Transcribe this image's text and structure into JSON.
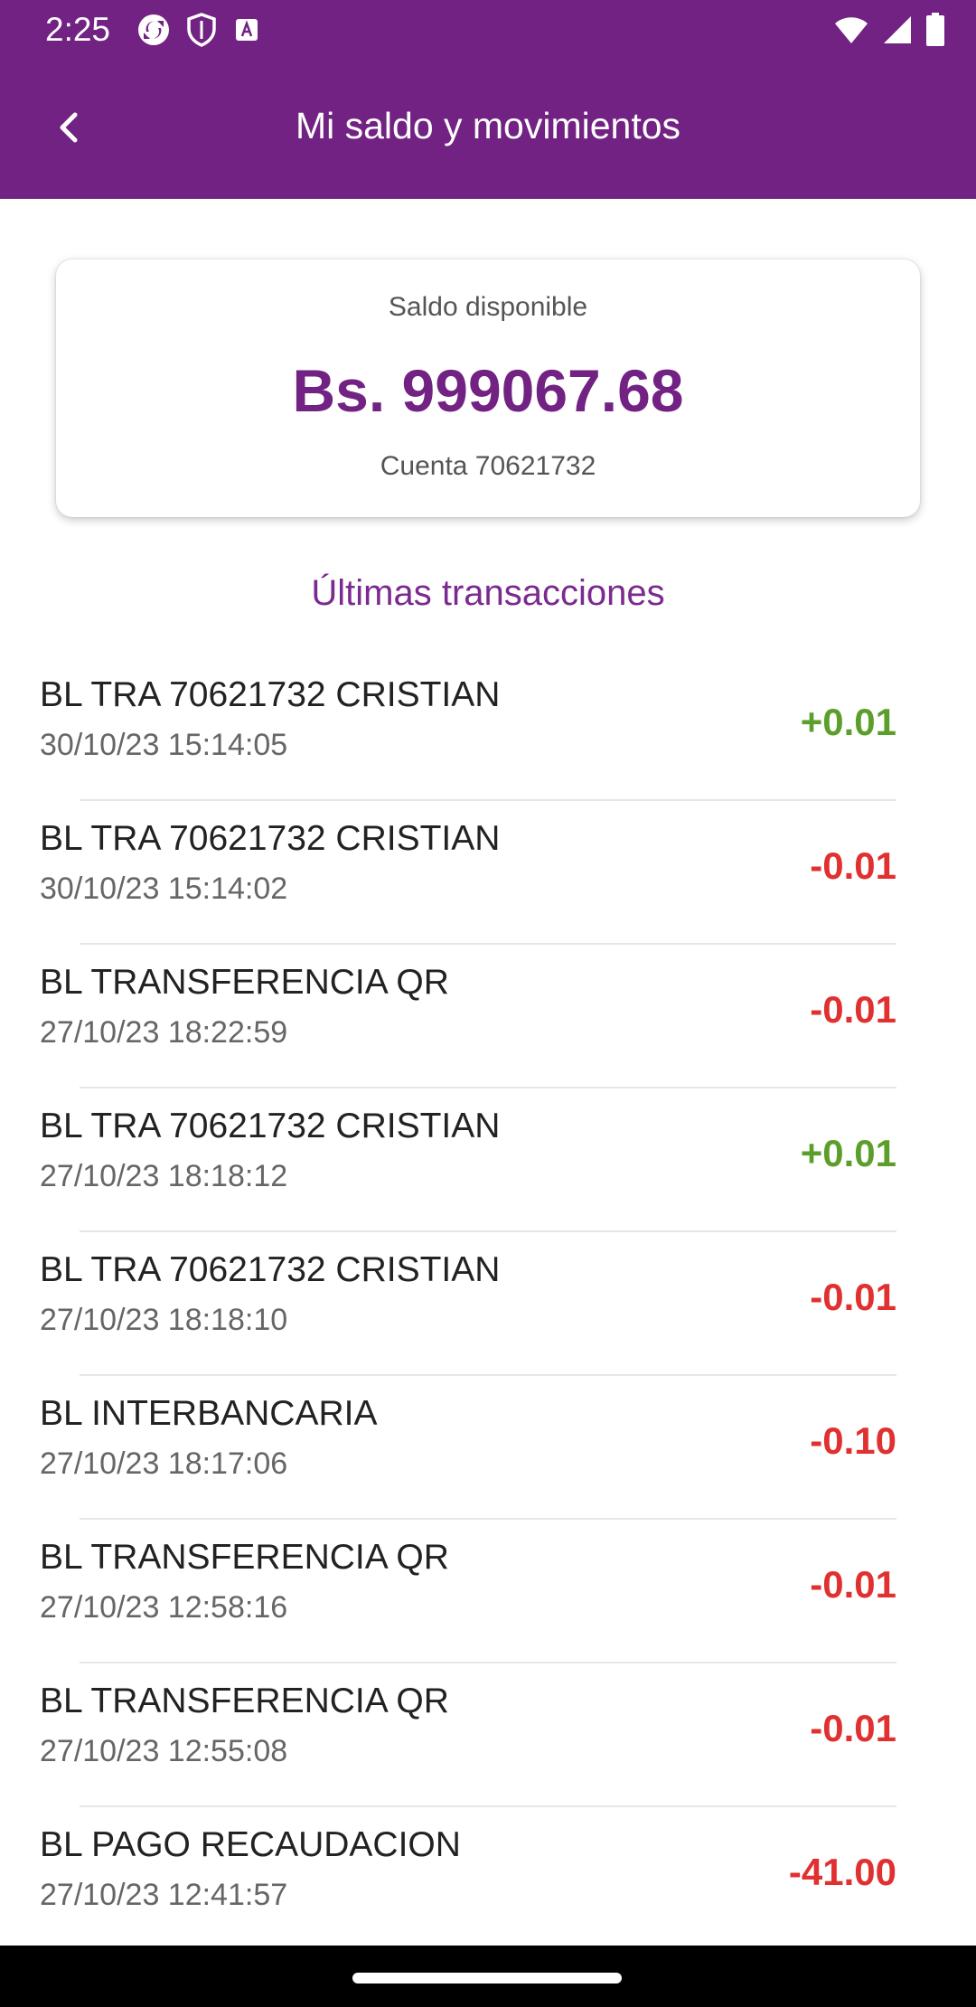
{
  "status_bar": {
    "time": "2:25",
    "left_icons": [
      "sync-app-icon",
      "shield-icon",
      "font-a-icon"
    ],
    "right_icons": [
      "wifi-icon",
      "signal-icon",
      "battery-icon"
    ]
  },
  "app_bar": {
    "title": "Mi saldo y movimientos",
    "back_icon": "chevron-left-icon",
    "background": "#722282"
  },
  "balance": {
    "label": "Saldo disponible",
    "amount": "Bs. 999067.68",
    "account": "Cuenta 70621732"
  },
  "transactions_section": {
    "title": "Últimas transacciones"
  },
  "transactions": [
    {
      "description": "BL TRA 70621732 CRISTIAN",
      "date": "30/10/23 15:14:05",
      "amount": "+0.01",
      "type": "credit"
    },
    {
      "description": "BL TRA 70621732 CRISTIAN",
      "date": "30/10/23 15:14:02",
      "amount": "-0.01",
      "type": "debit"
    },
    {
      "description": "BL TRANSFERENCIA QR",
      "date": "27/10/23 18:22:59",
      "amount": "-0.01",
      "type": "debit"
    },
    {
      "description": "BL TRA 70621732 CRISTIAN",
      "date": "27/10/23 18:18:12",
      "amount": "+0.01",
      "type": "credit"
    },
    {
      "description": "BL TRA 70621732 CRISTIAN",
      "date": "27/10/23 18:18:10",
      "amount": "-0.01",
      "type": "debit"
    },
    {
      "description": "BL INTERBANCARIA",
      "date": "27/10/23 18:17:06",
      "amount": "-0.10",
      "type": "debit"
    },
    {
      "description": "BL TRANSFERENCIA QR",
      "date": "27/10/23 12:58:16",
      "amount": "-0.01",
      "type": "debit"
    },
    {
      "description": "BL TRANSFERENCIA QR",
      "date": "27/10/23 12:55:08",
      "amount": "-0.01",
      "type": "debit"
    },
    {
      "description": "BL PAGO RECAUDACION",
      "date": "27/10/23 12:41:57",
      "amount": "-41.00",
      "type": "debit"
    }
  ],
  "colors": {
    "brand": "#722282",
    "credit": "#5c9e2a",
    "debit": "#e03030"
  }
}
